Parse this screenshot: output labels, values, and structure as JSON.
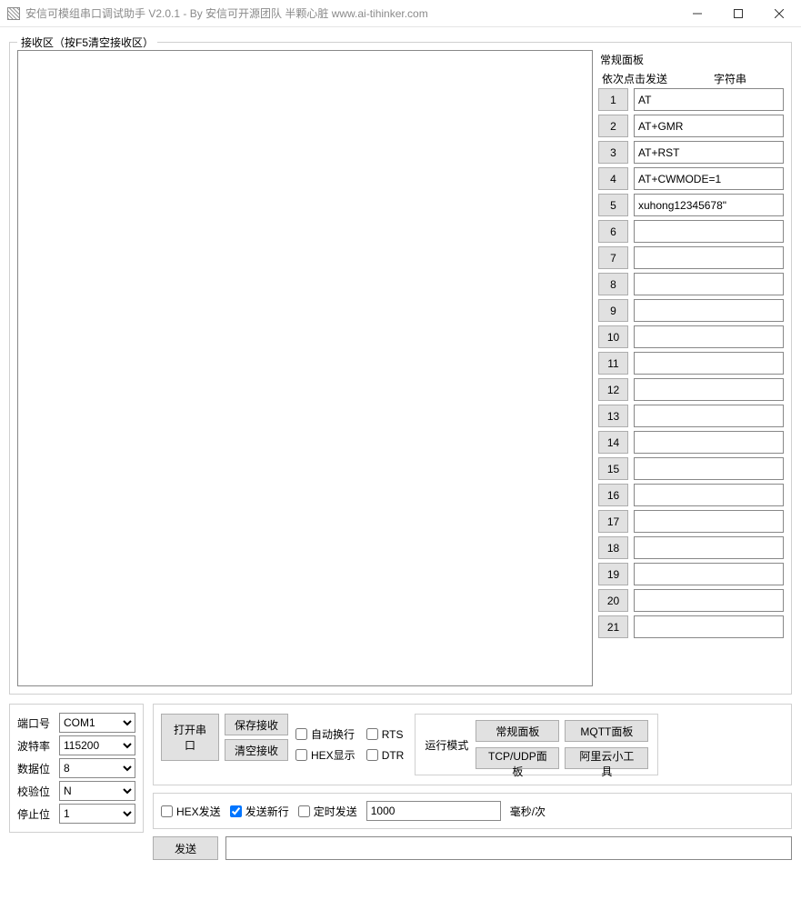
{
  "window": {
    "title": "安信可模组串口调试助手 V2.0.1 - By 安信可开源团队 半颗心脏 www.ai-tihinker.com"
  },
  "receive": {
    "legend": "接收区（按F5清空接收区）"
  },
  "sidepanel": {
    "title": "常规面板",
    "col_btn": "依次点击发送",
    "col_txt": "字符串",
    "rows": [
      {
        "n": "1",
        "v": "AT"
      },
      {
        "n": "2",
        "v": "AT+GMR"
      },
      {
        "n": "3",
        "v": "AT+RST"
      },
      {
        "n": "4",
        "v": "AT+CWMODE=1"
      },
      {
        "n": "5",
        "v": "xuhong12345678\""
      },
      {
        "n": "6",
        "v": ""
      },
      {
        "n": "7",
        "v": ""
      },
      {
        "n": "8",
        "v": ""
      },
      {
        "n": "9",
        "v": ""
      },
      {
        "n": "10",
        "v": ""
      },
      {
        "n": "11",
        "v": ""
      },
      {
        "n": "12",
        "v": ""
      },
      {
        "n": "13",
        "v": ""
      },
      {
        "n": "14",
        "v": ""
      },
      {
        "n": "15",
        "v": ""
      },
      {
        "n": "16",
        "v": ""
      },
      {
        "n": "17",
        "v": ""
      },
      {
        "n": "18",
        "v": ""
      },
      {
        "n": "19",
        "v": ""
      },
      {
        "n": "20",
        "v": ""
      },
      {
        "n": "21",
        "v": ""
      }
    ]
  },
  "serial": {
    "port_label": "端口号",
    "port_value": "COM1",
    "baud_label": "波特率",
    "baud_value": "115200",
    "data_label": "数据位",
    "data_value": "8",
    "parity_label": "校验位",
    "parity_value": "N",
    "stop_label": "停止位",
    "stop_value": "1"
  },
  "controls": {
    "open": "打开串口",
    "save_recv": "保存接收",
    "clear_recv": "清空接收",
    "auto_wrap": "自动换行",
    "hex_show": "HEX显示",
    "rts": "RTS",
    "dtr": "DTR",
    "mode_label": "运行模式",
    "mode_normal": "常规面板",
    "mode_mqtt": "MQTT面板",
    "mode_tcp": "TCP/UDP面板",
    "mode_ali": "阿里云小工具"
  },
  "send_opts": {
    "hex_send": "HEX发送",
    "send_newline": "发送新行",
    "send_newline_checked": true,
    "timed_send": "定时发送",
    "interval": "1000",
    "unit": "毫秒/次"
  },
  "send": {
    "button": "发送",
    "value": ""
  }
}
